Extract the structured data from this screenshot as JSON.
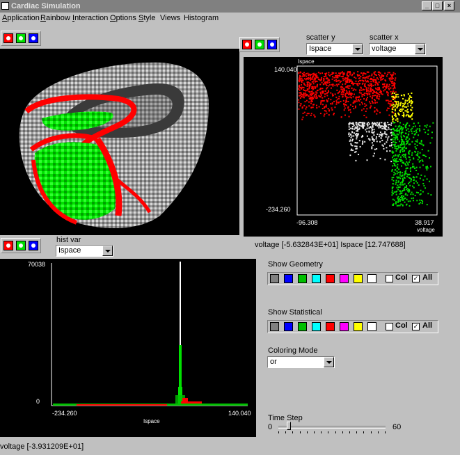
{
  "window": {
    "title": "Cardiac Simulation",
    "controls": [
      "_",
      "□",
      "×"
    ]
  },
  "menu": [
    {
      "label": "Application",
      "ul": "A",
      "rest": "pplication"
    },
    {
      "label": "Rainbow",
      "ul": "R",
      "rest": "ainbow"
    },
    {
      "label": "Interaction",
      "ul": "I",
      "rest": "nteraction"
    },
    {
      "label": "Options",
      "ul": "O",
      "rest": "ptions"
    },
    {
      "label": "Style",
      "ul": "S",
      "rest": "tyle"
    },
    {
      "label": "Views",
      "ul": "",
      "rest": "Views"
    },
    {
      "label": "Histogram",
      "ul": "",
      "rest": "Histogram"
    }
  ],
  "colors": {
    "red": "#ff0000",
    "green": "#00e000",
    "blue": "#0000ff",
    "grey": "#c0c0c0"
  },
  "scatter": {
    "y_label": "scatter y",
    "x_label": "scatter x",
    "y_value": "Ispace",
    "x_value": "voltage",
    "plot_ylabel": "Ispace",
    "plot_xlabel": "voltage",
    "y_max": "140.040",
    "y_min": "-234.260",
    "x_min": "-96.308",
    "x_max": "38.917",
    "readout": "voltage  [-5.632843E+01]  Ispace  [12.747688]"
  },
  "histogram": {
    "var_label": "hist var",
    "var_value": "Ispace",
    "y_max": "70038",
    "y_min": "0",
    "x_min": "-234.260",
    "x_max": "140.040",
    "xlabel": "Ispace",
    "readout": "voltage  [-3.931209E+01]"
  },
  "geometry": {
    "label": "Show Geometry",
    "col_label": "Col",
    "all_label": "All",
    "all_checked": "✓"
  },
  "statistical": {
    "label": "Show Statistical",
    "col_label": "Col",
    "all_label": "All",
    "all_checked": "✓"
  },
  "swatches": [
    "#808080",
    "#0000ff",
    "#00c000",
    "#00ffff",
    "#ff0000",
    "#ff00ff",
    "#ffff00",
    "#ffffff"
  ],
  "coloring": {
    "label": "Coloring Mode",
    "value": "or"
  },
  "timestep": {
    "label": "Time Step",
    "min": "0",
    "max": "60",
    "value": 5
  }
}
